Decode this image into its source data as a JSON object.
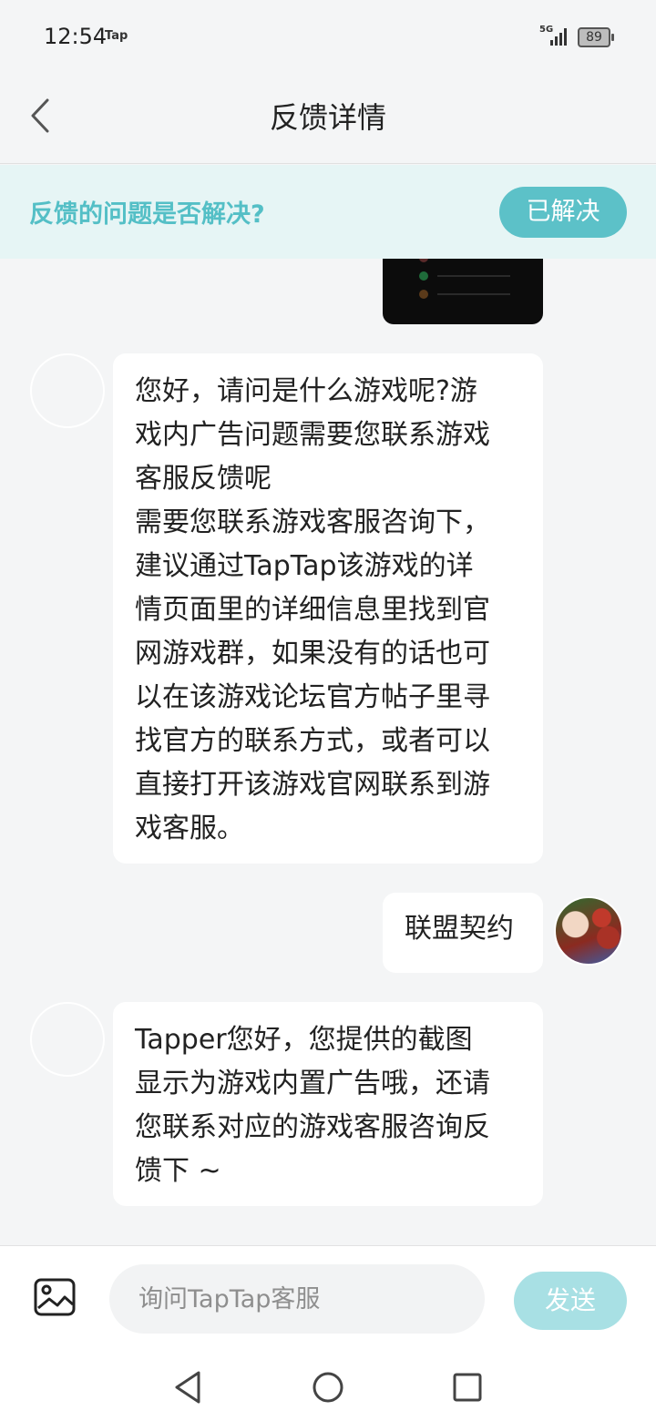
{
  "status_bar": {
    "time": "12:54",
    "app_tag": "Tap",
    "network": "5G",
    "battery": "89"
  },
  "header": {
    "title": "反馈详情"
  },
  "banner": {
    "question": "反馈的问题是否解决?",
    "resolved_label": "已解决"
  },
  "messages": [
    {
      "from": "support",
      "text": "您好，请问是什么游戏呢?游\n戏内广告问题需要您联系游戏\n客服反馈呢\n需要您联系游戏客服咨询下，\n建议通过TapTap该游戏的详\n情页面里的详细信息里找到官\n网游戏群，如果没有的话也可\n以在该游戏论坛官方帖子里寻\n找官方的联系方式，或者可以\n直接打开该游戏官网联系到游\n戏客服。"
    },
    {
      "from": "user",
      "text": "联盟契约"
    },
    {
      "from": "support",
      "text": "Tapper您好，您提供的截图\n显示为游戏内置广告哦，还请\n您联系对应的游戏客服咨询反\n馈下 ~"
    }
  ],
  "composer": {
    "placeholder": "询问TapTap客服",
    "send_label": "发送"
  },
  "colors": {
    "accent": "#5cc1c8",
    "accent_text": "#54bfc6",
    "banner_bg": "#e6f5f5",
    "send_disabled": "#a8e0e4"
  }
}
